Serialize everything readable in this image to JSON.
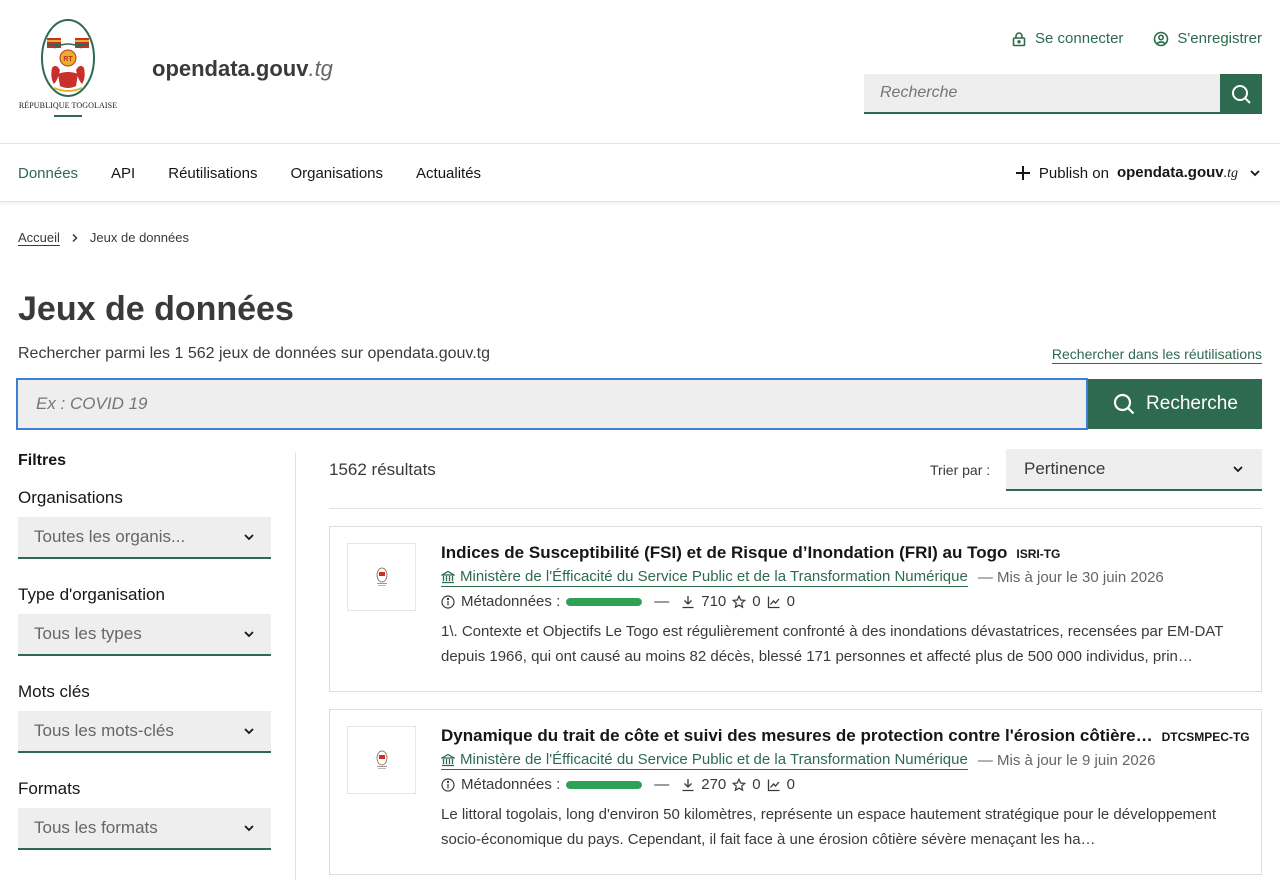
{
  "header": {
    "logo_text": "RÉPUBLIQUE TOGOLAISE",
    "logo_badge": "RT",
    "site_name": "opendata.gouv",
    "site_tld": ".tg",
    "login_label": "Se connecter",
    "register_label": "S'enregistrer",
    "search_placeholder": "Recherche"
  },
  "nav": {
    "items": [
      {
        "label": "Données",
        "active": true
      },
      {
        "label": "API"
      },
      {
        "label": "Réutilisations"
      },
      {
        "label": "Organisations"
      },
      {
        "label": "Actualités"
      }
    ],
    "publish_prefix": "Publish on",
    "publish_site": "opendata.gouv",
    "publish_tld": ".tg"
  },
  "breadcrumb": {
    "home": "Accueil",
    "current": "Jeux de données"
  },
  "page": {
    "title": "Jeux de données",
    "subtitle": "Rechercher parmi les 1 562 jeux de données sur opendata.gouv.tg",
    "reuse_link": "Rechercher dans les réutilisations",
    "search_placeholder": "Ex : COVID 19",
    "search_button": "Recherche"
  },
  "filters": {
    "title": "Filtres",
    "groups": [
      {
        "label": "Organisations",
        "value": "Toutes les organis..."
      },
      {
        "label": "Type d'organisation",
        "value": "Tous les types"
      },
      {
        "label": "Mots clés",
        "value": "Tous les mots-clés"
      },
      {
        "label": "Formats",
        "value": "Tous les formats"
      }
    ]
  },
  "results": {
    "count": "1562 résultats",
    "sort_label": "Trier par :",
    "sort_value": "Pertinence",
    "items": [
      {
        "title": "Indices de Susceptibilité (FSI) et de Risque d’Inondation (FRI) au Togo",
        "acronym": "ISRI-TG",
        "org": "Ministère de l'Éfficacité du Service Public et de la Transformation Numérique",
        "updated": "— Mis à jour le 30 juin 2026",
        "metadata_label": "Métadonnées :",
        "metadata_quality": 1.0,
        "sep": "—",
        "downloads": "710",
        "favorites": "0",
        "reuses": "0",
        "description": "1\\. Contexte et Objectifs Le Togo est régulièrement confronté à des inondations dévastatrices, recensées par EM-DAT depuis 1966, qui ont causé au moins 82 décès, blessé 171 personnes et affecté plus de 500 000 individus, prin…"
      },
      {
        "title": "Dynamique du trait de côte et suivi des mesures de protection contre l'érosion côtière…",
        "acronym": "DTCSMPEC-TG",
        "org": "Ministère de l'Éfficacité du Service Public et de la Transformation Numérique",
        "updated": "— Mis à jour le 9 juin 2026",
        "metadata_label": "Métadonnées :",
        "metadata_quality": 1.0,
        "sep": "—",
        "downloads": "270",
        "favorites": "0",
        "reuses": "0",
        "description": "Le littoral togolais, long d'environ 50 kilomètres, représente un espace hautement stratégique pour le développement socio-économique du pays. Cependant, il fait face à une érosion côtière sévère menaçant les ha…"
      }
    ]
  },
  "colors": {
    "primary": "#2e6a4f",
    "focus": "#3c7fd0",
    "quality": "#2fa157"
  }
}
